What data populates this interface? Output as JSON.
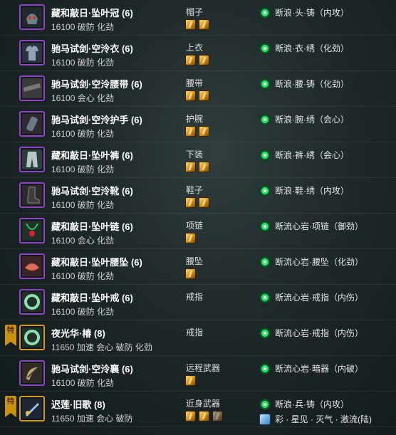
{
  "colors": {
    "purple_border": "#8e44c4",
    "gold_border": "#d49b1f",
    "enchant_green": "#2fe06a"
  },
  "items": [
    {
      "name": "藏和敲日·坠叶冠 (6)",
      "stats": "16100 破防 化劲",
      "slot": "帽子",
      "gems": 2,
      "enchant": "断浪·头·铸（内攻）",
      "icon": "helmet-icon",
      "quality": "purple"
    },
    {
      "name": "驰马试剑·空泠衣 (6)",
      "stats": "16100 破防 化劲",
      "slot": "上衣",
      "gems": 2,
      "enchant": "断浪·衣·绣（化劲）",
      "icon": "armor-icon",
      "quality": "purple"
    },
    {
      "name": "驰马试剑·空泠腰带 (6)",
      "stats": "16100 会心 化劲",
      "slot": "腰带",
      "gems": 2,
      "enchant": "断浪·腰·铸（化劲）",
      "icon": "belt-icon",
      "quality": "purple"
    },
    {
      "name": "驰马试剑·空泠护手 (6)",
      "stats": "16100 破防 化劲",
      "slot": "护腕",
      "gems": 2,
      "enchant": "断浪·腕·绣（会心）",
      "icon": "bracer-icon",
      "quality": "purple"
    },
    {
      "name": "藏和敲日·坠叶裤 (6)",
      "stats": "16100 破防 化劲",
      "slot": "下装",
      "gems": 2,
      "enchant": "断浪·裤·绣（会心）",
      "icon": "pants-icon",
      "quality": "purple"
    },
    {
      "name": "驰马试剑·空泠靴 (6)",
      "stats": "16100 破防 化劲",
      "slot": "鞋子",
      "gems": 2,
      "enchant": "断浪·鞋·绣（内攻）",
      "icon": "boots-icon",
      "quality": "purple"
    },
    {
      "name": "藏和敲日·坠叶链 (6)",
      "stats": "16100 会心 化劲",
      "slot": "项链",
      "gems": 1,
      "enchant": "断流心岩·项链（御劲）",
      "icon": "necklace-icon",
      "quality": "purple"
    },
    {
      "name": "藏和敲日·坠叶腰坠 (6)",
      "stats": "16100 破防 化劲",
      "slot": "腰坠",
      "gems": 1,
      "enchant": "断流心岩·腰坠（化劲）",
      "icon": "pendant-icon",
      "quality": "purple"
    },
    {
      "name": "藏和敲日·坠叶戒 (6)",
      "stats": "16100 破防 化劲",
      "slot": "戒指",
      "gems": 0,
      "enchant": "断流心岩·戒指（内伤）",
      "icon": "ring-icon",
      "quality": "purple"
    },
    {
      "name": "夜光华·椿 (8)",
      "stats": "11650 加速 会心 破防 化劲",
      "slot": "戒指",
      "gems": 0,
      "enchant": "断流心岩·戒指（内伤）",
      "icon": "ring-icon",
      "quality": "gold",
      "badge": "特"
    },
    {
      "name": "驰马试剑·空泠襄 (6)",
      "stats": "16100 破防 化劲",
      "slot": "远程武器",
      "gems": 1,
      "enchant": "断流心岩·暗器（内破）",
      "icon": "ranged-weapon-icon",
      "quality": "purple"
    },
    {
      "name": "迟莲·旧歌 (8)",
      "stats": "11650 加速 会心 破防",
      "slot": "近身武器",
      "gems": 3,
      "enchant": "断浪·兵·铸（内攻）",
      "enchant2": "彩 · 星见 · 灭气 · 激流(陆)",
      "icon": "melee-weapon-icon",
      "quality": "gold",
      "badge": "特"
    }
  ]
}
